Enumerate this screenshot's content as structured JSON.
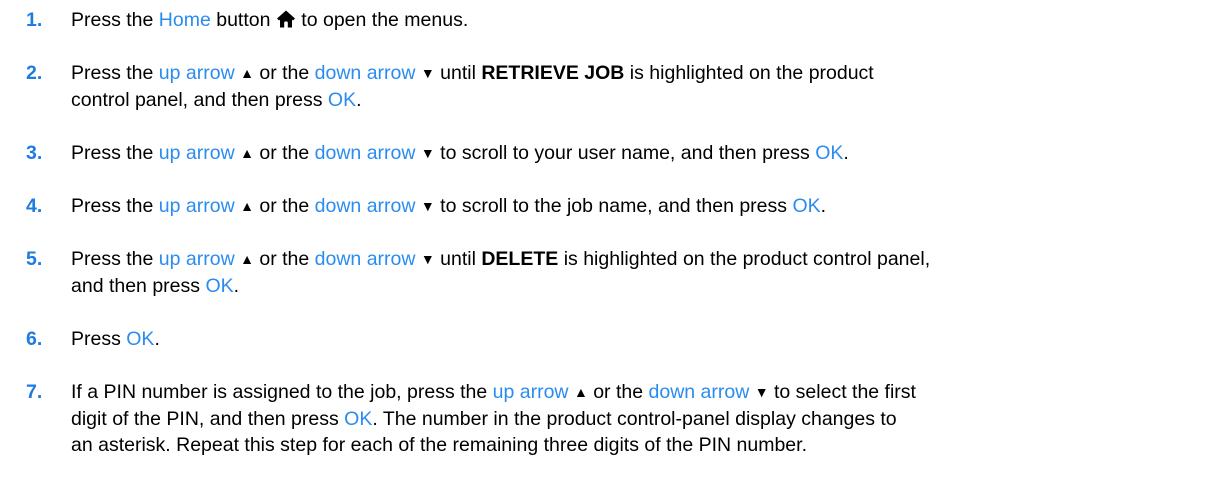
{
  "icons": {
    "home": "home-icon",
    "up": "up-arrow-icon",
    "down": "down-arrow-icon"
  },
  "glyphs": {
    "up": "▲",
    "down": "▼"
  },
  "colors": {
    "number": "#1e7be0",
    "link": "#2b8cf0"
  },
  "steps": [
    {
      "number": "1.",
      "parts": {
        "a": "Press the ",
        "home": "Home",
        "b": " button ",
        "c": " to open the menus."
      }
    },
    {
      "number": "2.",
      "parts": {
        "a": "Press the ",
        "up": "up arrow",
        "b": " or the ",
        "down": "down arrow",
        "c": " until ",
        "bold": "RETRIEVE JOB",
        "d": " is highlighted on the product",
        "e": "control panel, and then press ",
        "ok": "OK",
        "f": "."
      }
    },
    {
      "number": "3.",
      "parts": {
        "a": "Press the ",
        "up": "up arrow",
        "b": " or the ",
        "down": "down arrow",
        "c": " to scroll to your user name, and then press ",
        "ok": "OK",
        "d": "."
      }
    },
    {
      "number": "4.",
      "parts": {
        "a": "Press the ",
        "up": "up arrow",
        "b": " or the ",
        "down": "down arrow",
        "c": " to scroll to the job name, and then press ",
        "ok": "OK",
        "d": "."
      }
    },
    {
      "number": "5.",
      "parts": {
        "a": "Press the ",
        "up": "up arrow",
        "b": " or the ",
        "down": "down arrow",
        "c": " until ",
        "bold": "DELETE",
        "d": " is highlighted on the product control panel,",
        "e": "and then press ",
        "ok": "OK",
        "f": "."
      }
    },
    {
      "number": "6.",
      "parts": {
        "a": "Press ",
        "ok": "OK",
        "b": "."
      }
    },
    {
      "number": "7.",
      "parts": {
        "a": "If a PIN number is assigned to the job, press the ",
        "up": "up arrow",
        "b": " or the ",
        "down": "down arrow",
        "c": " to select the first",
        "d": "digit of the PIN, and then press ",
        "ok": "OK",
        "e": ". The number in the product control-panel display changes to",
        "f": "an asterisk. Repeat this step for each of the remaining three digits of the PIN number."
      }
    }
  ]
}
